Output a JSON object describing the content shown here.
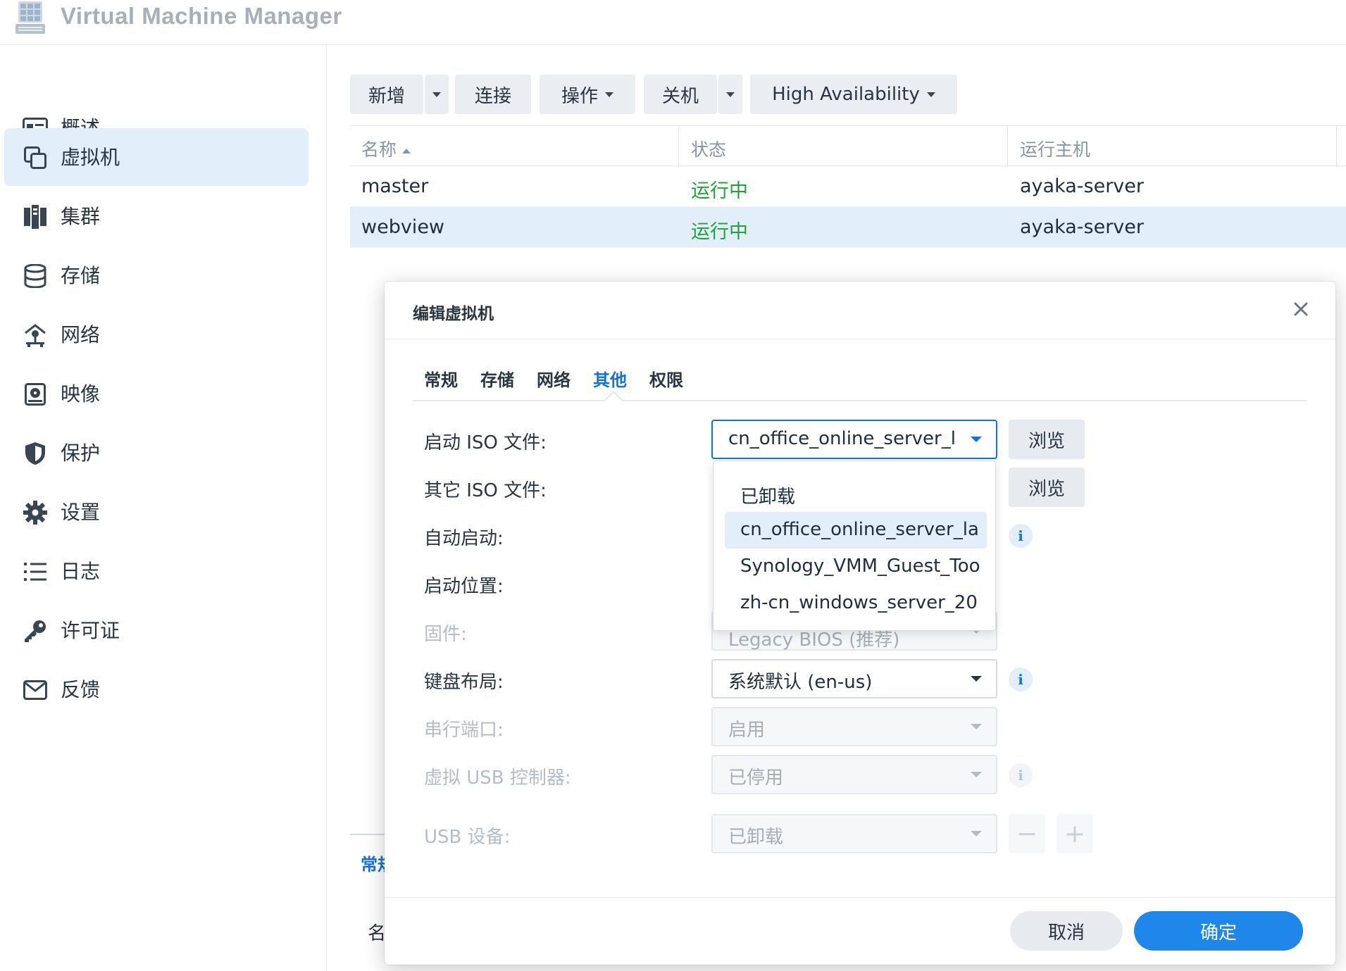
{
  "app": {
    "title": "Virtual Machine Manager"
  },
  "sidebar": {
    "items": [
      {
        "label": "概述",
        "icon": "overview-card-icon"
      },
      {
        "label": "虚拟机",
        "icon": "vm-copy-icon",
        "active": true
      },
      {
        "label": "集群",
        "icon": "cluster-icon"
      },
      {
        "label": "存储",
        "icon": "storage-disk-icon"
      },
      {
        "label": "网络",
        "icon": "network-icon"
      },
      {
        "label": "映像",
        "icon": "image-disc-icon"
      },
      {
        "label": "保护",
        "icon": "shield-icon"
      },
      {
        "label": "设置",
        "icon": "gear-icon"
      },
      {
        "label": "日志",
        "icon": "list-icon"
      },
      {
        "label": "许可证",
        "icon": "key-icon"
      },
      {
        "label": "反馈",
        "icon": "mail-icon"
      }
    ]
  },
  "toolbar": {
    "add": "新增",
    "connect": "连接",
    "action": "操作",
    "shutdown": "关机",
    "ha": "High Availability"
  },
  "vm_table": {
    "columns": [
      "名称",
      "状态",
      "运行主机"
    ],
    "rows": [
      {
        "name": "master",
        "status": "运行中",
        "host": "ayaka-server"
      },
      {
        "name": "webview",
        "status": "运行中",
        "host": "ayaka-server",
        "selected": true
      }
    ]
  },
  "background": {
    "tab_label": "常规",
    "name_label": "名"
  },
  "dialog": {
    "title": "编辑虚拟机",
    "tabs": [
      "常规",
      "存储",
      "网络",
      "其他",
      "权限"
    ],
    "active_tab": "其他",
    "fields": {
      "boot_iso": {
        "label": "启动 ISO 文件:",
        "value": "cn_office_online_server_l",
        "browse": "浏览"
      },
      "other_iso": {
        "label": "其它 ISO 文件:",
        "browse": "浏览"
      },
      "autostart": {
        "label": "自动启动:"
      },
      "boot_order": {
        "label": "启动位置:"
      },
      "firmware": {
        "label": "固件:",
        "value": "Legacy BIOS (推荐)"
      },
      "keyboard": {
        "label": "键盘布局:",
        "value": "系统默认 (en-us)"
      },
      "serial": {
        "label": "串行端口:",
        "value": "启用"
      },
      "usb_controller": {
        "label": "虚拟 USB 控制器:",
        "value": "已停用"
      },
      "usb_device": {
        "label": "USB 设备:",
        "value": "已卸载"
      }
    },
    "dropdown_options": [
      "已卸载",
      "cn_office_online_server_la",
      "Synology_VMM_Guest_Too",
      "zh-cn_windows_server_20"
    ],
    "buttons": {
      "cancel": "取消",
      "ok": "确定"
    }
  },
  "colors": {
    "accent": "#1472d6",
    "primary_button": "#1f86ea",
    "status_running": "#1fa336",
    "selected_row": "#e3eefb"
  }
}
